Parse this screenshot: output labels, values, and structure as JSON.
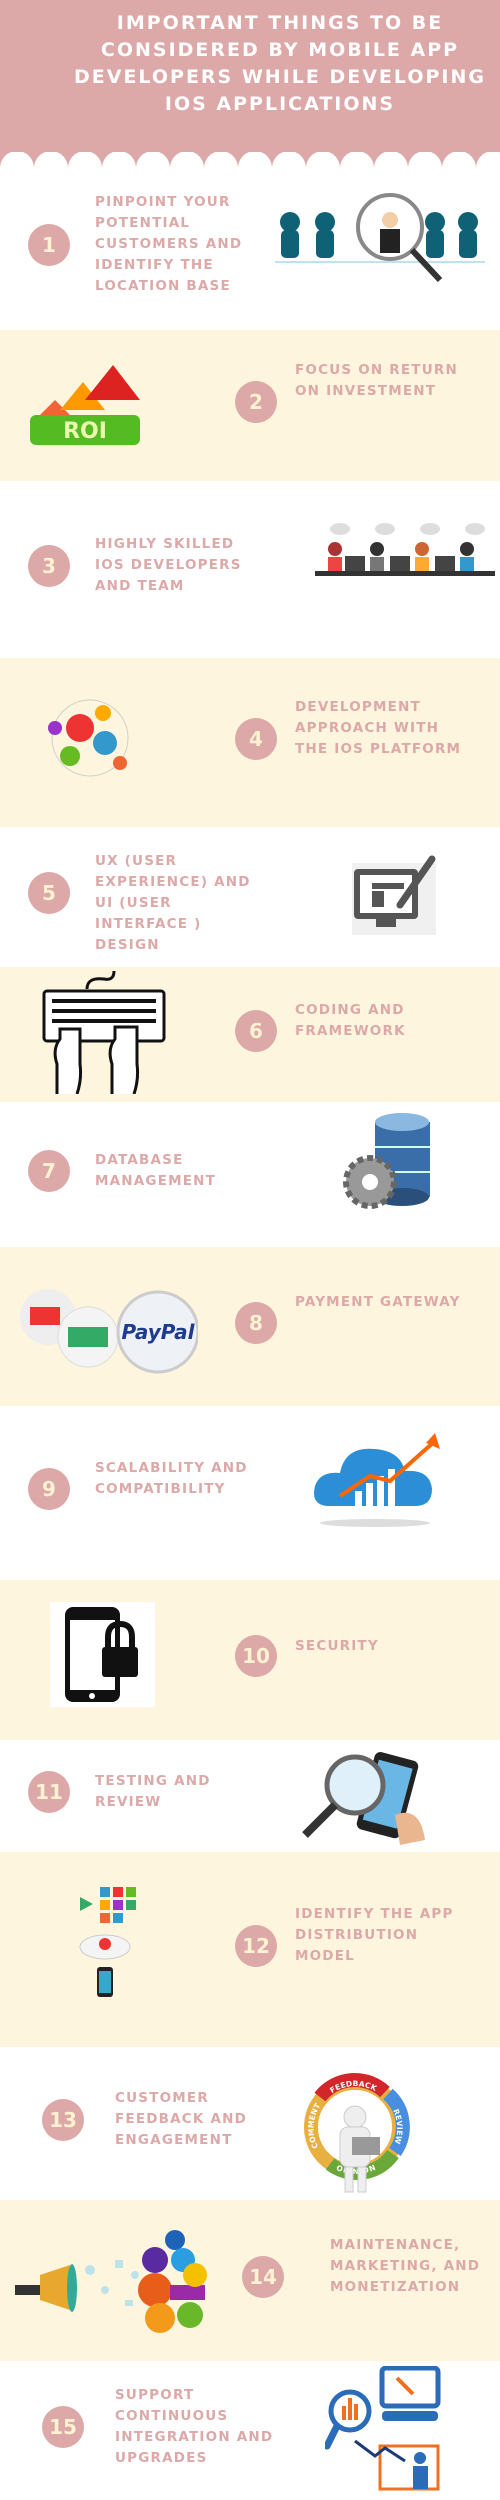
{
  "title": "IMPORTANT THINGS TO BE CONSIDERED BY MOBILE APP DEVELOPERS WHILE DEVELOPING IOS APPLICATIONS",
  "colors": {
    "header": "#dca8a8",
    "accent_text": "#dca8a8",
    "number_text": "#fdf2d2",
    "alt_background": "#fdf5dd"
  },
  "items": [
    {
      "number": "1",
      "label": "PINPOINT YOUR POTENTIAL CUSTOMERS AND IDENTIFY THE LOCATION BASE",
      "icon": "magnifier-customers-icon"
    },
    {
      "number": "2",
      "label": "FOCUS ON RETURN ON INVESTMENT",
      "icon": "roi-arrows-icon"
    },
    {
      "number": "3",
      "label": "HIGHLY SKILLED IOS DEVELOPERS AND TEAM",
      "icon": "developer-team-icon"
    },
    {
      "number": "4",
      "label": "DEVELOPMENT APPROACH WITH THE IOS PLATFORM",
      "icon": "gears-icon"
    },
    {
      "number": "5",
      "label": "UX (USER EXPERIENCE) AND UI (USER INTERFACE ) DESIGN",
      "icon": "monitor-brush-icon"
    },
    {
      "number": "6",
      "label": "CODING AND FRAMEWORK",
      "icon": "keyboard-hands-icon"
    },
    {
      "number": "7",
      "label": "DATABASE MANAGEMENT",
      "icon": "database-gear-icon"
    },
    {
      "number": "8",
      "label": "PAYMENT GATEWAY",
      "icon": "payment-cards-icon",
      "brand": "PayPal"
    },
    {
      "number": "9",
      "label": "SCALABILITY AND COMPATIBILITY",
      "icon": "cloud-growth-chart-icon"
    },
    {
      "number": "10",
      "label": "SECURITY",
      "icon": "phone-lock-icon"
    },
    {
      "number": "11",
      "label": "TESTING AND REVIEW",
      "icon": "phone-magnifier-icon"
    },
    {
      "number": "12",
      "label": "IDENTIFY THE APP DISTRIBUTION MODEL",
      "icon": "app-distribution-icon"
    },
    {
      "number": "13",
      "label": "CUSTOMER FEEDBACK AND ENGAGEMENT",
      "icon": "feedback-cycle-icon",
      "ring_words": [
        "FEEDBACK",
        "REVIEW",
        "OPINION",
        "COMMENT"
      ]
    },
    {
      "number": "14",
      "label": "MAINTENANCE, MARKETING, AND MONETIZATION",
      "icon": "megaphone-social-icon"
    },
    {
      "number": "15",
      "label": "SUPPORT CONTINUOUS INTEGRATION AND UPGRADES",
      "icon": "analytics-presentation-icon"
    }
  ]
}
